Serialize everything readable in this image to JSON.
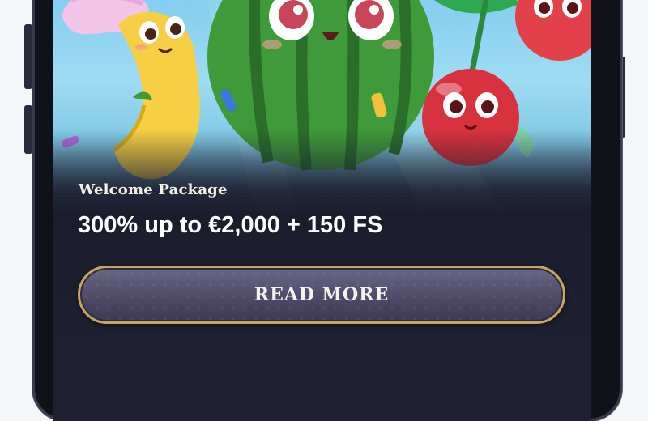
{
  "promo": {
    "subtitle": "Welcome Package",
    "headline": "300% up to €2,000 + 150 FS",
    "cta_label": "READ MORE"
  },
  "hero": {
    "characters": [
      "banana-character",
      "watermelon-character",
      "cherry-character"
    ]
  },
  "colors": {
    "screen_bg": "#1b1d2e",
    "cta_border": "#c8a55e",
    "cta_fill": "#4e4a68",
    "text": "#ffffff"
  }
}
